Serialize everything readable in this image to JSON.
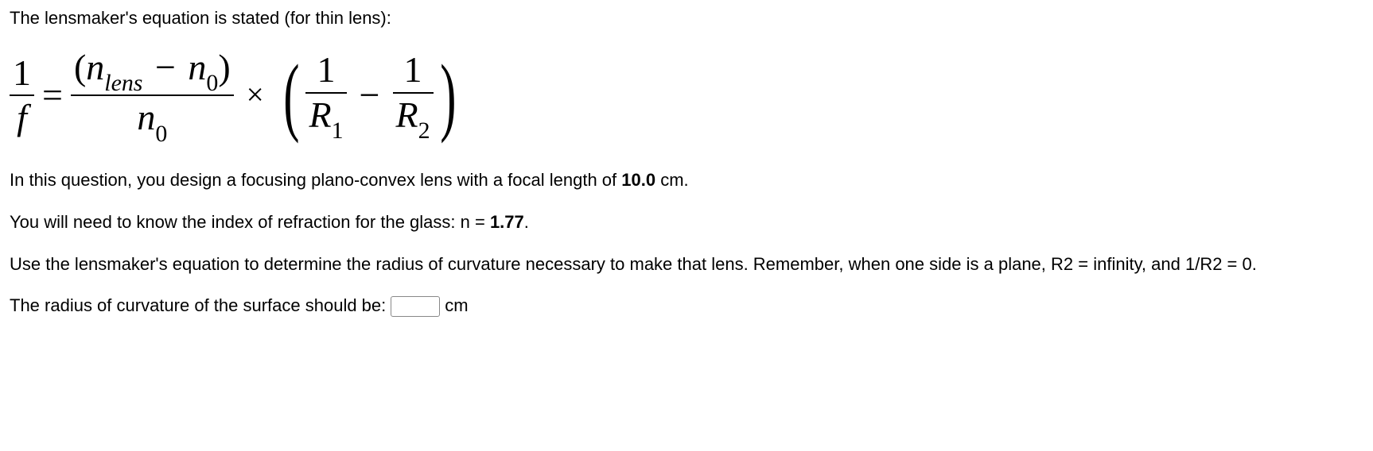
{
  "intro": "The lensmaker's equation is stated (for thin lens):",
  "equation": {
    "lhs_num": "1",
    "lhs_den": "f",
    "eq": "=",
    "rhs1_num_open": "(",
    "rhs1_num_nlens": "n",
    "rhs1_num_nlens_sub": "lens",
    "rhs1_num_minus": "−",
    "rhs1_num_n0": "n",
    "rhs1_num_n0_sub": "0",
    "rhs1_num_close": ")",
    "rhs1_den_n0": "n",
    "rhs1_den_n0_sub": "0",
    "times": "×",
    "r_frac1_num": "1",
    "r_frac1_den": "R",
    "r_frac1_den_sub": "1",
    "r_minus": "−",
    "r_frac2_num": "1",
    "r_frac2_den": "R",
    "r_frac2_den_sub": "2"
  },
  "p1_pre": "In this question, you design a focusing plano-convex lens with a focal length of ",
  "p1_val": "10.0",
  "p1_post": " cm.",
  "p2_pre": "You will need to know the index of refraction for the glass: n = ",
  "p2_val": "1.77",
  "p2_post": ".",
  "p3": "Use the lensmaker's equation to determine the radius of curvature necessary to make that lens. Remember, when one side is a plane, R2 = infinity, and 1/R2 = 0.",
  "answer_prompt": "The radius of curvature of the surface should be:",
  "answer_unit": "cm",
  "answer_value": ""
}
